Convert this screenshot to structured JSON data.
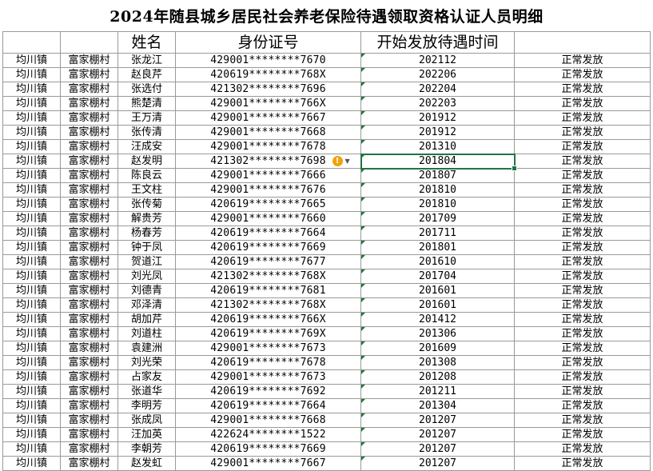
{
  "title": "2024年随县城乡居民社会养老保险待遇领取资格认证人员明细",
  "colors": {
    "grid": "#9a9a9a",
    "selection": "#217346",
    "warning": "#f0a30a"
  },
  "headers": [
    "",
    "",
    "姓名",
    "身份证号",
    "开始发放待遇时间",
    ""
  ],
  "warning_icon": "warning-icon",
  "rows": [
    {
      "town": "均川镇",
      "village": "富家棚村",
      "name": "张龙江",
      "id": "429001********7670",
      "date": "202112",
      "status": "正常发放"
    },
    {
      "town": "均川镇",
      "village": "富家棚村",
      "name": "赵良芹",
      "id": "420619********768X",
      "date": "202206",
      "status": "正常发放"
    },
    {
      "town": "均川镇",
      "village": "富家棚村",
      "name": "张选付",
      "id": "421302********7696",
      "date": "202204",
      "status": "正常发放"
    },
    {
      "town": "均川镇",
      "village": "富家棚村",
      "name": "熊楚清",
      "id": "429001********766X",
      "date": "202203",
      "status": "正常发放"
    },
    {
      "town": "均川镇",
      "village": "富家棚村",
      "name": "王万清",
      "id": "429001********7667",
      "date": "201912",
      "status": "正常发放"
    },
    {
      "town": "均川镇",
      "village": "富家棚村",
      "name": "张传清",
      "id": "429001********7668",
      "date": "201912",
      "status": "正常发放"
    },
    {
      "town": "均川镇",
      "village": "富家棚村",
      "name": "汪成安",
      "id": "429001********7678",
      "date": "201310",
      "status": "正常发放"
    },
    {
      "town": "均川镇",
      "village": "富家棚村",
      "name": "赵发明",
      "id": "421302********7698",
      "date": "201804",
      "status": "正常发放"
    },
    {
      "town": "均川镇",
      "village": "富家棚村",
      "name": "陈良云",
      "id": "429001********7666",
      "date": "201807",
      "status": "正常发放"
    },
    {
      "town": "均川镇",
      "village": "富家棚村",
      "name": "王文柱",
      "id": "429001********7676",
      "date": "201810",
      "status": "正常发放"
    },
    {
      "town": "均川镇",
      "village": "富家棚村",
      "name": "张传菊",
      "id": "420619********7665",
      "date": "201810",
      "status": "正常发放"
    },
    {
      "town": "均川镇",
      "village": "富家棚村",
      "name": "解贵芳",
      "id": "429001********7660",
      "date": "201709",
      "status": "正常发放"
    },
    {
      "town": "均川镇",
      "village": "富家棚村",
      "name": "杨春芳",
      "id": "420619********7664",
      "date": "201711",
      "status": "正常发放"
    },
    {
      "town": "均川镇",
      "village": "富家棚村",
      "name": "钟于凤",
      "id": "420619********7669",
      "date": "201801",
      "status": "正常发放"
    },
    {
      "town": "均川镇",
      "village": "富家棚村",
      "name": "贺道江",
      "id": "420619********7677",
      "date": "201610",
      "status": "正常发放"
    },
    {
      "town": "均川镇",
      "village": "富家棚村",
      "name": "刘光凤",
      "id": "421302********768X",
      "date": "201704",
      "status": "正常发放"
    },
    {
      "town": "均川镇",
      "village": "富家棚村",
      "name": "刘德青",
      "id": "420619********7681",
      "date": "201601",
      "status": "正常发放"
    },
    {
      "town": "均川镇",
      "village": "富家棚村",
      "name": "邓泽清",
      "id": "421302********768X",
      "date": "201601",
      "status": "正常发放"
    },
    {
      "town": "均川镇",
      "village": "富家棚村",
      "name": "胡加芹",
      "id": "420619********766X",
      "date": "201412",
      "status": "正常发放"
    },
    {
      "town": "均川镇",
      "village": "富家棚村",
      "name": "刘道柱",
      "id": "420619********769X",
      "date": "201306",
      "status": "正常发放"
    },
    {
      "town": "均川镇",
      "village": "富家棚村",
      "name": "袁建洲",
      "id": "429001********7673",
      "date": "201609",
      "status": "正常发放"
    },
    {
      "town": "均川镇",
      "village": "富家棚村",
      "name": "刘光荣",
      "id": "420619********7678",
      "date": "201308",
      "status": "正常发放"
    },
    {
      "town": "均川镇",
      "village": "富家棚村",
      "name": "占家友",
      "id": "429001********7673",
      "date": "201208",
      "status": "正常发放"
    },
    {
      "town": "均川镇",
      "village": "富家棚村",
      "name": "张道华",
      "id": "420619********7692",
      "date": "201211",
      "status": "正常发放"
    },
    {
      "town": "均川镇",
      "village": "富家棚村",
      "name": "李明芳",
      "id": "420619********7664",
      "date": "201304",
      "status": "正常发放"
    },
    {
      "town": "均川镇",
      "village": "富家棚村",
      "name": "张成凤",
      "id": "429001********7668",
      "date": "201207",
      "status": "正常发放"
    },
    {
      "town": "均川镇",
      "village": "富家棚村",
      "name": "汪加英",
      "id": "422624********1522",
      "date": "201207",
      "status": "正常发放"
    },
    {
      "town": "均川镇",
      "village": "富家棚村",
      "name": "李朝芳",
      "id": "420619********7669",
      "date": "201207",
      "status": "正常发放"
    },
    {
      "town": "均川镇",
      "village": "富家棚村",
      "name": "赵发虹",
      "id": "429001********7667",
      "date": "201207",
      "status": "正常发放"
    }
  ]
}
